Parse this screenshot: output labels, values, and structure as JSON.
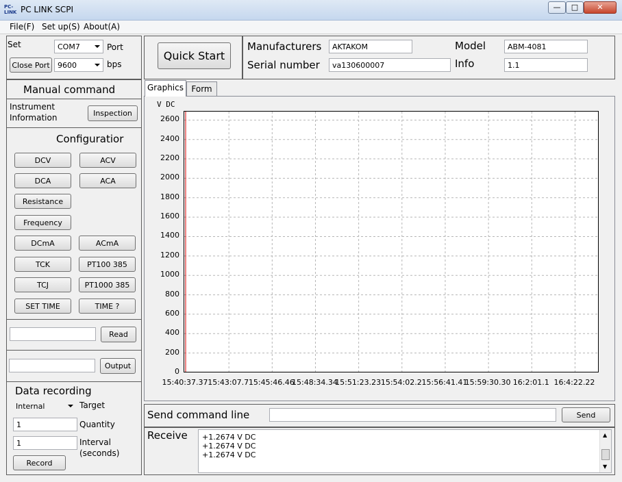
{
  "window": {
    "title": "PC LINK SCPI",
    "icon_text": "PC-LINK"
  },
  "menu": [
    {
      "label": "File(F)"
    },
    {
      "label": "Set up(S)"
    },
    {
      "label": "About(A)"
    }
  ],
  "connection": {
    "set_label": "Set",
    "port_value": "COM7",
    "port_label": "Port",
    "close_port_label": "Close Port",
    "baud_value": "9600",
    "baud_label": "bps"
  },
  "quick_start_label": "Quick Start",
  "instrument": {
    "manufacturers_label": "Manufacturers",
    "manufacturers_value": "AKTAKOM",
    "model_label": "Model",
    "model_value": "ABM-4081",
    "serial_label": "Serial number",
    "serial_value": "va130600007",
    "info_label": "Info",
    "info_value": "1.1"
  },
  "manual_command": {
    "title": "Manual command",
    "instrument_info_label": "Instrument Information",
    "inspection_label": "Inspection"
  },
  "configuration": {
    "title": "Configuratior",
    "buttons": [
      "DCV",
      "ACV",
      "DCA",
      "ACA",
      "Resistance",
      "Frequency",
      "DCmA",
      "ACmA",
      "TCK",
      "PT100 385",
      "TCJ",
      "PT1000 385",
      "SET TIME",
      "TIME ?"
    ]
  },
  "read": {
    "value": "",
    "button_label": "Read"
  },
  "output": {
    "value": "",
    "button_label": "Output"
  },
  "data_recording": {
    "title": "Data recording",
    "target_value": "Internal",
    "target_label": "Target",
    "quantity_value": "1",
    "quantity_label": "Quantity",
    "interval_value": "1",
    "interval_label": "Interval (seconds)",
    "record_label": "Record"
  },
  "tabs": [
    {
      "label": "Graphics",
      "active": true
    },
    {
      "label": "Form",
      "active": false
    }
  ],
  "chart_data": {
    "type": "line",
    "ylabel": "V DC",
    "ylim": [
      0,
      2680
    ],
    "yticks": [
      0,
      200,
      400,
      600,
      800,
      1000,
      1200,
      1400,
      1600,
      1800,
      2000,
      2200,
      2400,
      2600
    ],
    "xticks": [
      "15:40:37.37",
      "15:43:07.7",
      "15:45:46.46",
      "15:48:34.34",
      "15:51:23.23",
      "15:54:02.2",
      "15:56:41.41",
      "15:59:30.30",
      "16:2:01.1",
      "16:4:22.22"
    ],
    "series": [
      {
        "color": "#d40000",
        "values": [
          1.2674,
          1.2674,
          1.2674
        ]
      }
    ],
    "grid": true,
    "grid_style": "dashed"
  },
  "send": {
    "label": "Send command line",
    "value": "",
    "button_label": "Send"
  },
  "receive": {
    "label": "Receive",
    "lines": [
      "+1.2674 V DC",
      "+1.2674 V DC",
      "+1.2674 V DC"
    ]
  },
  "colors": {
    "series": "#d40000",
    "grid": "#b5b5b5"
  }
}
